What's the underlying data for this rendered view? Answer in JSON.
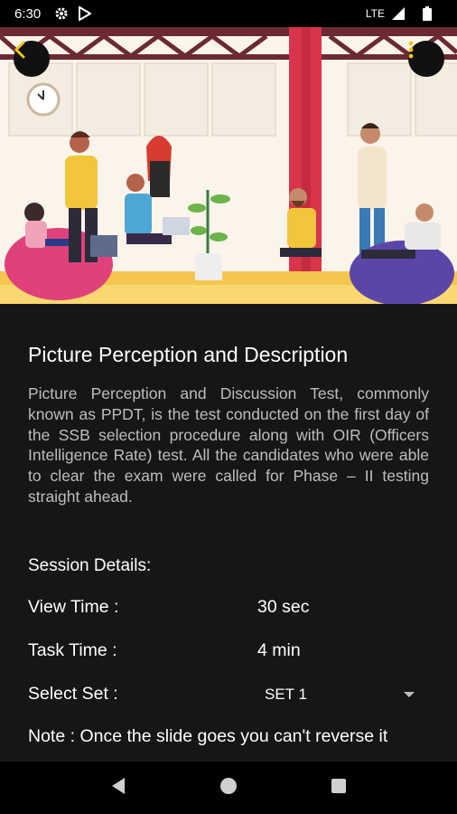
{
  "status_bar": {
    "time": "6:30",
    "network": "LTE",
    "icons": [
      "gear-icon",
      "play-store-icon",
      "signal-icon",
      "battery-icon"
    ]
  },
  "hero": {
    "image": "team-meeting-illustration",
    "back_icon": "chevron-left-icon",
    "menu_icon": "more-vert-icon",
    "accent_color": "#f5c518"
  },
  "content": {
    "title": "Picture Perception and Description",
    "description": "Picture Perception and Discussion Test, commonly known as PPDT, is the test conducted on the first day of the SSB selection procedure along with OIR (Officers Intelligence Rate) test. All the candidates who were able to clear the exam were called for Phase – II testing straight ahead.",
    "session_label": "Session Details:",
    "view_time": {
      "label": "View Time :",
      "value": "30 sec"
    },
    "task_time": {
      "label": "Task Time :",
      "value": "4 min"
    },
    "select_set": {
      "label": "Select Set :",
      "value": "SET 1"
    },
    "note": "Note : Once the slide goes you can't reverse it"
  },
  "nav_bar": {
    "icons": [
      "back-triangle-icon",
      "home-circle-icon",
      "recents-square-icon"
    ]
  }
}
